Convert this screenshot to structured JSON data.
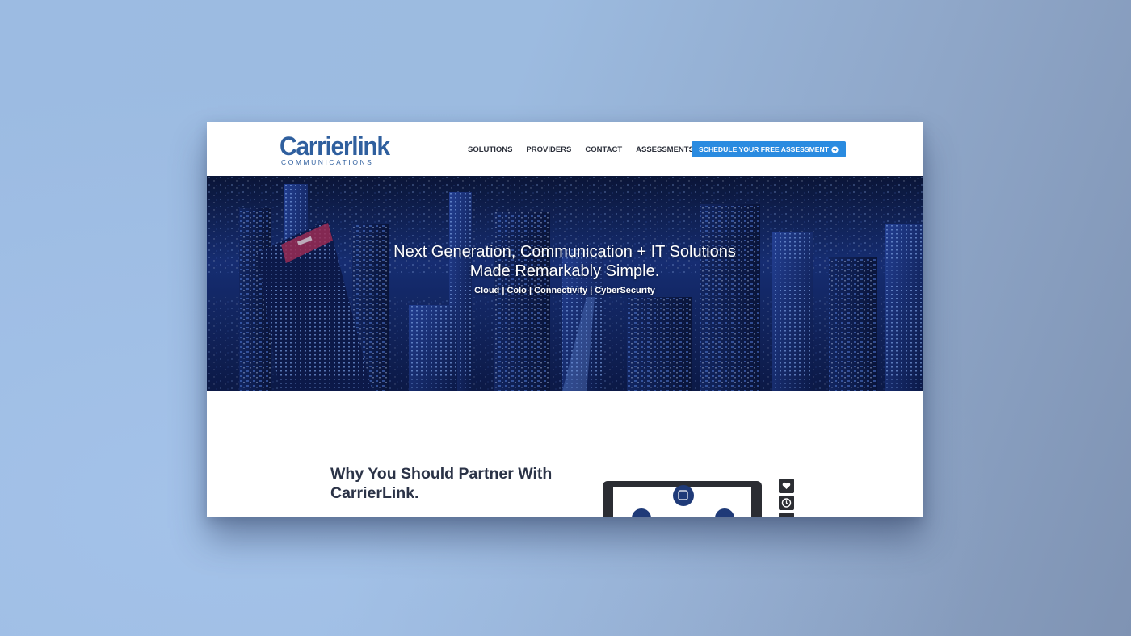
{
  "brand": {
    "name": "Carrierlink",
    "tagline": "COMMUNICATIONS",
    "color": "#2f5f9e"
  },
  "nav": {
    "items": [
      {
        "label": "SOLUTIONS"
      },
      {
        "label": "PROVIDERS"
      },
      {
        "label": "CONTACT"
      },
      {
        "label": "ASSESSMENTS"
      }
    ],
    "cta": {
      "label": "SCHEDULE YOUR FREE ASSESSMENT",
      "icon": "arrow-circle-right-icon",
      "color": "#2a8be0"
    }
  },
  "hero": {
    "title_line1": "Next Generation, Communication + IT Solutions",
    "title_line2": "Made Remarkably Simple.",
    "subtitle": "Cloud | Colo | Connectivity | CyberSecurity"
  },
  "section": {
    "heading_line1": "Why You Should Partner With",
    "heading_line2": "CarrierLink.",
    "side_icons": [
      "heart-icon",
      "clock-icon",
      "more-icon"
    ]
  },
  "colors": {
    "background": "#9cbbe2",
    "hero_dark": "#0e1d4f",
    "heading_text": "#2b3347"
  }
}
